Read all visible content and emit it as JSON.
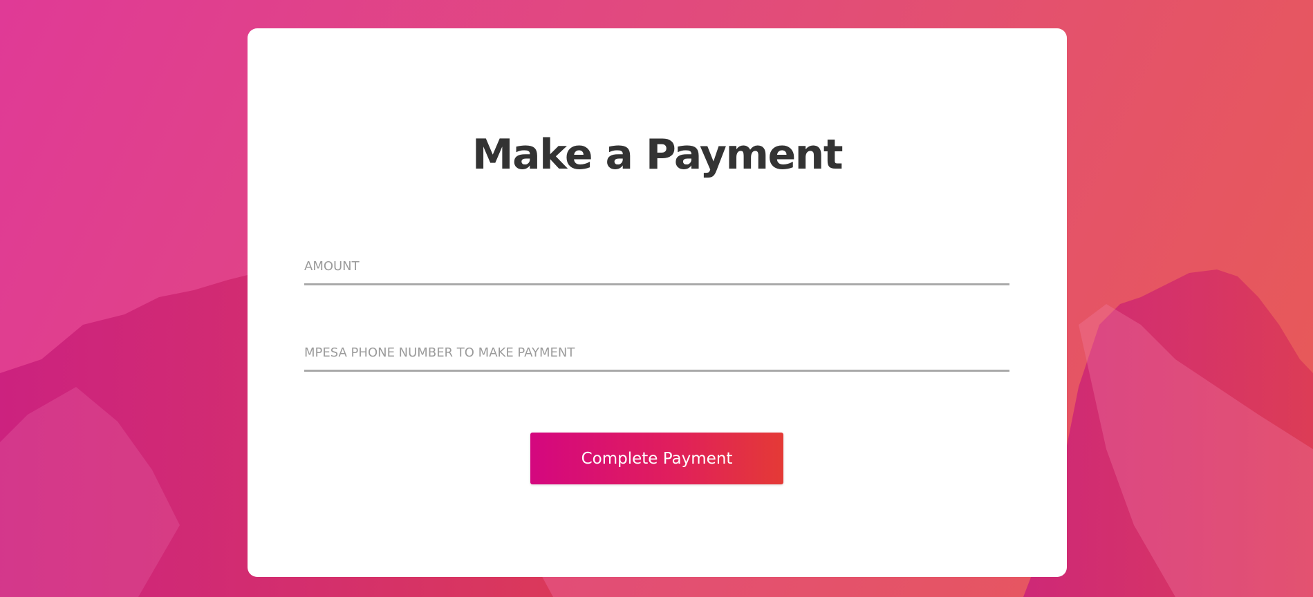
{
  "form": {
    "title": "Make a Payment",
    "amount_field": {
      "placeholder": "AMOUNT",
      "value": ""
    },
    "phone_field": {
      "placeholder": "MPESA PHONE NUMBER TO MAKE PAYMENT",
      "value": ""
    },
    "submit_label": "Complete Payment"
  },
  "colors": {
    "background_gradient": [
      "#e03a96",
      "#e14b7c",
      "#e85b55"
    ],
    "mountain": "#c2185b",
    "card": "#ffffff",
    "title": "#333333",
    "placeholder": "#9b9b9b",
    "field_underline": "#a9a9a9",
    "button_gradient": [
      "#d4077f",
      "#e43a36"
    ],
    "button_text": "#ffffff"
  }
}
